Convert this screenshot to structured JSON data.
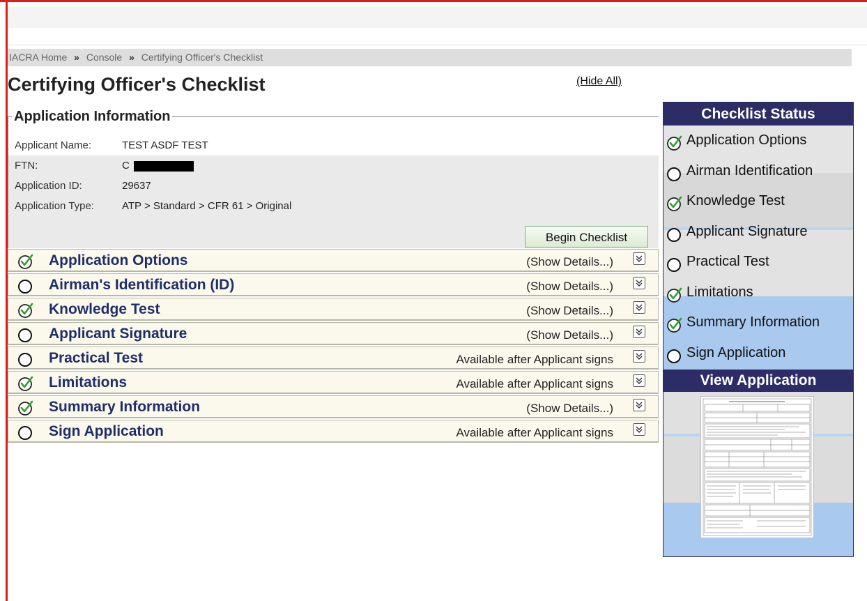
{
  "breadcrumb": {
    "home": "IACRA Home",
    "sep1": "»",
    "console": "Console",
    "sep2": "»",
    "current": "Certifying Officer's Checklist"
  },
  "page_title": "Certifying Officer's Checklist",
  "hide_all_label": "(Hide All)",
  "app_info": {
    "legend": "Application Information",
    "rows": [
      {
        "label": "Applicant Name:",
        "value": "TEST ASDF TEST"
      },
      {
        "label": "FTN:",
        "value": "C"
      },
      {
        "label": "Application ID:",
        "value": "29637"
      },
      {
        "label": "Application Type:",
        "value": "ATP > Standard > CFR 61 > Original"
      }
    ],
    "begin_button": "Begin Checklist"
  },
  "checklist": [
    {
      "title": "Application Options",
      "action": "(Show Details...)",
      "complete": true
    },
    {
      "title": "Airman's Identification (ID)",
      "action": "(Show Details...)",
      "complete": false
    },
    {
      "title": "Knowledge Test",
      "action": "(Show Details...)",
      "complete": true
    },
    {
      "title": "Applicant Signature",
      "action": "(Show Details...)",
      "complete": false
    },
    {
      "title": "Practical Test",
      "action": "Available after Applicant signs",
      "complete": false
    },
    {
      "title": "Limitations",
      "action": "Available after Applicant signs",
      "complete": true
    },
    {
      "title": "Summary Information",
      "action": "(Show Details...)",
      "complete": true
    },
    {
      "title": "Sign Application",
      "action": "Available after Applicant signs",
      "complete": false
    }
  ],
  "status_panel": {
    "title": "Checklist Status",
    "items": [
      {
        "label": "Application Options",
        "complete": true
      },
      {
        "label": "Airman Identification",
        "complete": false
      },
      {
        "label": "Knowledge Test",
        "complete": true
      },
      {
        "label": "Applicant Signature",
        "complete": false
      },
      {
        "label": "Practical Test",
        "complete": false
      },
      {
        "label": "Limitations",
        "complete": true
      },
      {
        "label": "Summary Information",
        "complete": true
      },
      {
        "label": "Sign Application",
        "complete": false
      }
    ],
    "view_title": "View Application"
  },
  "colors": {
    "frame": "#e11b1b",
    "row_title": "#1e2d6b",
    "panel_header": "#2c2c66",
    "check_green": "#2e9e2e"
  },
  "icons": {
    "complete": "check-circle-icon",
    "incomplete": "empty-circle-icon",
    "expand": "chevron-double-down-icon"
  }
}
